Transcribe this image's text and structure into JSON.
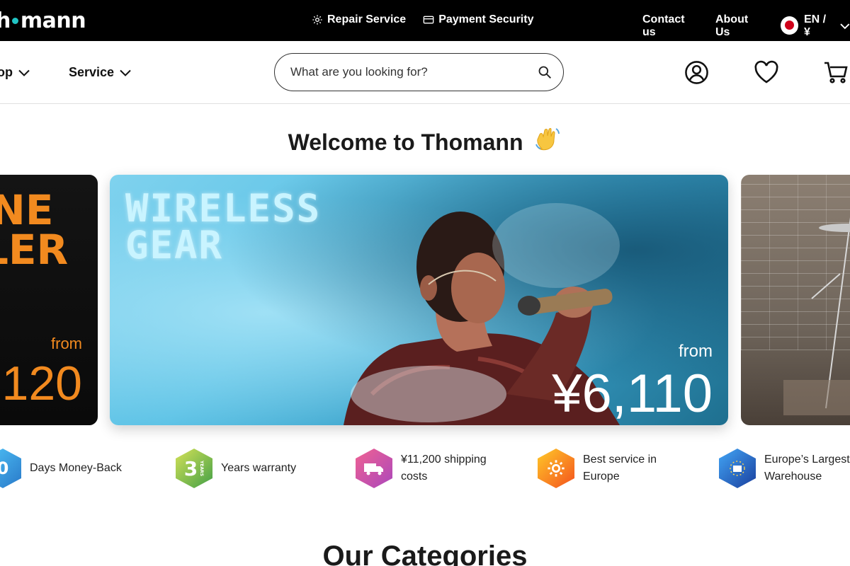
{
  "topbar": {
    "logo": "mann",
    "repair_service": "Repair Service",
    "payment_security": "Payment Security",
    "contact_us": "Contact us",
    "about_us": "About Us",
    "language_currency": "EN / ¥"
  },
  "nav": {
    "shop": "op",
    "service": "Service",
    "search_placeholder": "What are you looking for?"
  },
  "welcome": "Welcome to Thomann",
  "carousel": {
    "left": {
      "headline_1": "ONE",
      "headline_2": "LLER",
      "from": "from",
      "price": "120"
    },
    "main": {
      "headline_1": "WIRELESS",
      "headline_2": "GEAR",
      "from": "from",
      "price": "¥6,110"
    }
  },
  "features": [
    {
      "badge": "0",
      "badge_sub": "DAYS",
      "text_1": "Days Money-Back",
      "text_2": ""
    },
    {
      "badge": "3",
      "badge_sub": "YEARS",
      "text_1": "Years warranty",
      "text_2": ""
    },
    {
      "badge": "",
      "badge_sub": "",
      "text_1": "¥11,200 shipping",
      "text_2": "costs"
    },
    {
      "badge": "",
      "badge_sub": "",
      "text_1": "Best service in",
      "text_2": "Europe"
    },
    {
      "badge": "",
      "badge_sub": "",
      "text_1": "Europe’s Largest",
      "text_2": "Warehouse"
    }
  ],
  "categories_heading": "Our Categories",
  "colors": {
    "topbar_bg": "#000000",
    "logo_dot": "#21c4c4",
    "orange_promo": "#f28a1f",
    "flag_red": "#d0021b"
  },
  "icons": [
    "gear-icon",
    "card-icon",
    "flag-icon",
    "chevron-down-icon",
    "search-icon",
    "user-icon",
    "heart-icon",
    "cart-icon",
    "waving-hand-icon",
    "truck-icon",
    "service-gear-icon",
    "warehouse-icon"
  ]
}
